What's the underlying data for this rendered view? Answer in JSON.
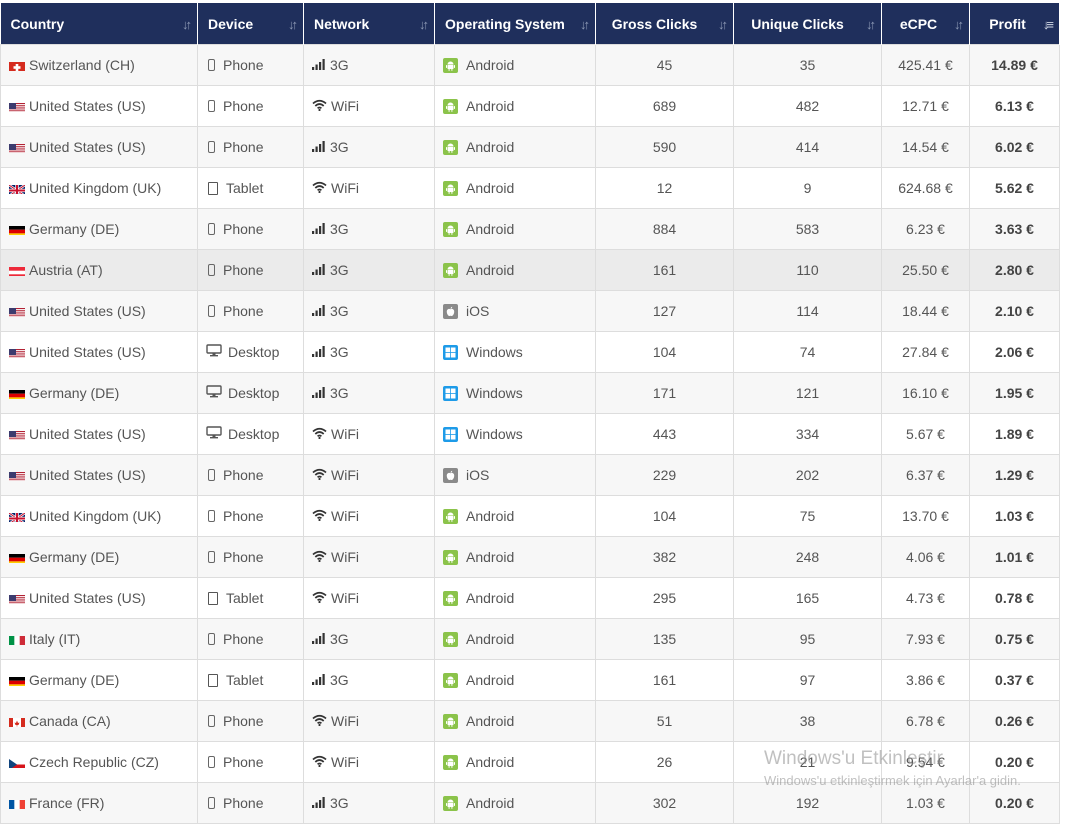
{
  "table": {
    "headers": [
      "Country",
      "Device",
      "Network",
      "Operating System",
      "Gross Clicks",
      "Unique Clicks",
      "eCPC",
      "Profit"
    ],
    "sorted_column": "Profit",
    "rows": [
      {
        "flag": "CH",
        "country": "Switzerland (CH)",
        "device": "Phone",
        "device_icon": "phone-icon",
        "network": "3G",
        "network_icon": "signal-bars-icon",
        "os": "Android",
        "os_icon": "android-icon",
        "gross_clicks": "45",
        "unique_clicks": "35",
        "ecpc": "425.41 €",
        "profit": "14.89 €"
      },
      {
        "flag": "US",
        "country": "United States (US)",
        "device": "Phone",
        "device_icon": "phone-icon",
        "network": "WiFi",
        "network_icon": "wifi-icon",
        "os": "Android",
        "os_icon": "android-icon",
        "gross_clicks": "689",
        "unique_clicks": "482",
        "ecpc": "12.71 €",
        "profit": "6.13 €"
      },
      {
        "flag": "US",
        "country": "United States (US)",
        "device": "Phone",
        "device_icon": "phone-icon",
        "network": "3G",
        "network_icon": "signal-bars-icon",
        "os": "Android",
        "os_icon": "android-icon",
        "gross_clicks": "590",
        "unique_clicks": "414",
        "ecpc": "14.54 €",
        "profit": "6.02 €"
      },
      {
        "flag": "UK",
        "country": "United Kingdom (UK)",
        "device": "Tablet",
        "device_icon": "tablet-icon",
        "network": "WiFi",
        "network_icon": "wifi-icon",
        "os": "Android",
        "os_icon": "android-icon",
        "gross_clicks": "12",
        "unique_clicks": "9",
        "ecpc": "624.68 €",
        "profit": "5.62 €"
      },
      {
        "flag": "DE",
        "country": "Germany (DE)",
        "device": "Phone",
        "device_icon": "phone-icon",
        "network": "3G",
        "network_icon": "signal-bars-icon",
        "os": "Android",
        "os_icon": "android-icon",
        "gross_clicks": "884",
        "unique_clicks": "583",
        "ecpc": "6.23 €",
        "profit": "3.63 €"
      },
      {
        "flag": "AT",
        "country": "Austria (AT)",
        "device": "Phone",
        "device_icon": "phone-icon",
        "network": "3G",
        "network_icon": "signal-bars-icon",
        "os": "Android",
        "os_icon": "android-icon",
        "gross_clicks": "161",
        "unique_clicks": "110",
        "ecpc": "25.50 €",
        "profit": "2.80 €",
        "highlighted": true
      },
      {
        "flag": "US",
        "country": "United States (US)",
        "device": "Phone",
        "device_icon": "phone-icon",
        "network": "3G",
        "network_icon": "signal-bars-icon",
        "os": "iOS",
        "os_icon": "apple-icon",
        "gross_clicks": "127",
        "unique_clicks": "114",
        "ecpc": "18.44 €",
        "profit": "2.10 €"
      },
      {
        "flag": "US",
        "country": "United States (US)",
        "device": "Desktop",
        "device_icon": "desktop-icon",
        "network": "3G",
        "network_icon": "signal-bars-icon",
        "os": "Windows",
        "os_icon": "windows-icon",
        "gross_clicks": "104",
        "unique_clicks": "74",
        "ecpc": "27.84 €",
        "profit": "2.06 €"
      },
      {
        "flag": "DE",
        "country": "Germany (DE)",
        "device": "Desktop",
        "device_icon": "desktop-icon",
        "network": "3G",
        "network_icon": "signal-bars-icon",
        "os": "Windows",
        "os_icon": "windows-icon",
        "gross_clicks": "171",
        "unique_clicks": "121",
        "ecpc": "16.10 €",
        "profit": "1.95 €"
      },
      {
        "flag": "US",
        "country": "United States (US)",
        "device": "Desktop",
        "device_icon": "desktop-icon",
        "network": "WiFi",
        "network_icon": "wifi-icon",
        "os": "Windows",
        "os_icon": "windows-icon",
        "gross_clicks": "443",
        "unique_clicks": "334",
        "ecpc": "5.67 €",
        "profit": "1.89 €"
      },
      {
        "flag": "US",
        "country": "United States (US)",
        "device": "Phone",
        "device_icon": "phone-icon",
        "network": "WiFi",
        "network_icon": "wifi-icon",
        "os": "iOS",
        "os_icon": "apple-icon",
        "gross_clicks": "229",
        "unique_clicks": "202",
        "ecpc": "6.37 €",
        "profit": "1.29 €"
      },
      {
        "flag": "UK",
        "country": "United Kingdom (UK)",
        "device": "Phone",
        "device_icon": "phone-icon",
        "network": "WiFi",
        "network_icon": "wifi-icon",
        "os": "Android",
        "os_icon": "android-icon",
        "gross_clicks": "104",
        "unique_clicks": "75",
        "ecpc": "13.70 €",
        "profit": "1.03 €"
      },
      {
        "flag": "DE",
        "country": "Germany (DE)",
        "device": "Phone",
        "device_icon": "phone-icon",
        "network": "WiFi",
        "network_icon": "wifi-icon",
        "os": "Android",
        "os_icon": "android-icon",
        "gross_clicks": "382",
        "unique_clicks": "248",
        "ecpc": "4.06 €",
        "profit": "1.01 €"
      },
      {
        "flag": "US",
        "country": "United States (US)",
        "device": "Tablet",
        "device_icon": "tablet-icon",
        "network": "WiFi",
        "network_icon": "wifi-icon",
        "os": "Android",
        "os_icon": "android-icon",
        "gross_clicks": "295",
        "unique_clicks": "165",
        "ecpc": "4.73 €",
        "profit": "0.78 €"
      },
      {
        "flag": "IT",
        "country": "Italy (IT)",
        "device": "Phone",
        "device_icon": "phone-icon",
        "network": "3G",
        "network_icon": "signal-bars-icon",
        "os": "Android",
        "os_icon": "android-icon",
        "gross_clicks": "135",
        "unique_clicks": "95",
        "ecpc": "7.93 €",
        "profit": "0.75 €"
      },
      {
        "flag": "DE",
        "country": "Germany (DE)",
        "device": "Tablet",
        "device_icon": "tablet-icon",
        "network": "3G",
        "network_icon": "signal-bars-icon",
        "os": "Android",
        "os_icon": "android-icon",
        "gross_clicks": "161",
        "unique_clicks": "97",
        "ecpc": "3.86 €",
        "profit": "0.37 €"
      },
      {
        "flag": "CA",
        "country": "Canada (CA)",
        "device": "Phone",
        "device_icon": "phone-icon",
        "network": "WiFi",
        "network_icon": "wifi-icon",
        "os": "Android",
        "os_icon": "android-icon",
        "gross_clicks": "51",
        "unique_clicks": "38",
        "ecpc": "6.78 €",
        "profit": "0.26 €"
      },
      {
        "flag": "CZ",
        "country": "Czech Republic (CZ)",
        "device": "Phone",
        "device_icon": "phone-icon",
        "network": "WiFi",
        "network_icon": "wifi-icon",
        "os": "Android",
        "os_icon": "android-icon",
        "gross_clicks": "26",
        "unique_clicks": "21",
        "ecpc": "9.54 €",
        "profit": "0.20 €"
      },
      {
        "flag": "FR",
        "country": "France (FR)",
        "device": "Phone",
        "device_icon": "phone-icon",
        "network": "3G",
        "network_icon": "signal-bars-icon",
        "os": "Android",
        "os_icon": "android-icon",
        "gross_clicks": "302",
        "unique_clicks": "192",
        "ecpc": "1.03 €",
        "profit": "0.20 €"
      }
    ]
  },
  "watermark": {
    "line1": "Windows'u Etkinleştir",
    "line2": "Windows'u etkinleştirmek için Ayarlar'a gidin."
  },
  "colors": {
    "header_bg": "#1f2f5c",
    "android": "#8bc34a",
    "windows": "#1e9be8",
    "ios": "#8a8a8a"
  }
}
